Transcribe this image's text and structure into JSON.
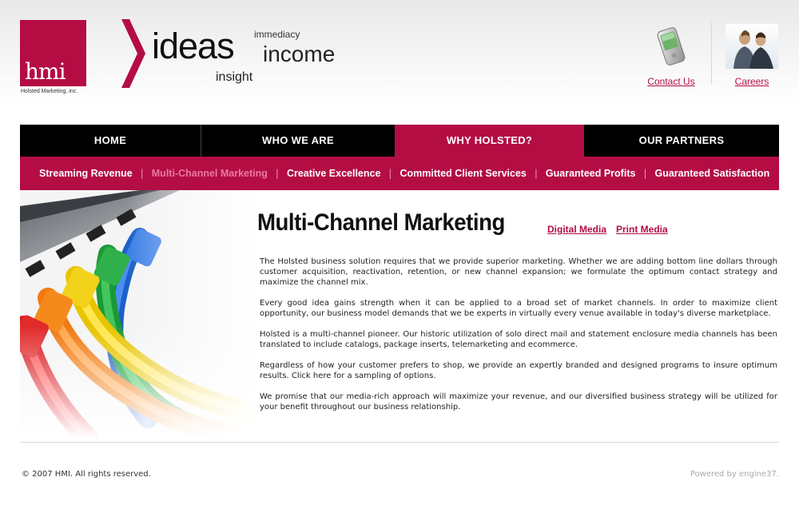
{
  "brand": {
    "logo_text": "hmi",
    "caption": "Holsted Marketing, inc.",
    "accent": "#b40d44",
    "tagline_words": {
      "ideas": "ideas",
      "immediacy": "immediacy",
      "income": "income",
      "insight": "insight"
    }
  },
  "header_links": {
    "contact": {
      "label": "Contact Us",
      "icon": "pda-phone-icon"
    },
    "careers": {
      "label": "Careers",
      "icon": "business-people-icon"
    }
  },
  "main_nav": [
    {
      "label": "HOME"
    },
    {
      "label": "WHO WE ARE"
    },
    {
      "label": "WHY HOLSTED?",
      "active": true
    },
    {
      "label": "OUR PARTNERS"
    }
  ],
  "sub_nav": [
    {
      "label": "Streaming Revenue"
    },
    {
      "label": "Multi-Channel Marketing",
      "active": true
    },
    {
      "label": "Creative Excellence"
    },
    {
      "label": "Committed Client Services"
    },
    {
      "label": "Guaranteed Profits"
    },
    {
      "label": "Guaranteed Satisfaction"
    }
  ],
  "content": {
    "title": "Multi-Channel Marketing",
    "links": [
      "Digital Media",
      "Print Media"
    ],
    "paragraphs": [
      "The Holsted business solution requires that we provide superior marketing. Whether we are adding bottom line dollars through customer acquisition, reactivation, retention, or new channel expansion; we formulate the optimum contact strategy and maximize the channel mix.",
      "Every good idea gains strength when it can be applied to a broad set of market channels. In order to maximize client opportunity, our business model demands that we be experts in virtually every venue available in today's diverse marketplace.",
      "Holsted is a multi-channel pioneer. Our historic utilization of solo direct mail and statement enclosure media channels has been translated to include catalogs, package inserts, telemarketing and ecommerce.",
      "Regardless of how your customer prefers to shop, we provide an expertly branded and designed programs to insure optimum results. Click here for a sampling of options.",
      "We promise that our media-rich approach will maximize your revenue, and our diversified business strategy will be utilized for your benefit throughout our business relationship."
    ],
    "hero_image": "colorful-network-cables-image"
  },
  "footer": {
    "copyright": "© 2007 HMI. All rights reserved.",
    "powered": "Powered by engine37."
  }
}
